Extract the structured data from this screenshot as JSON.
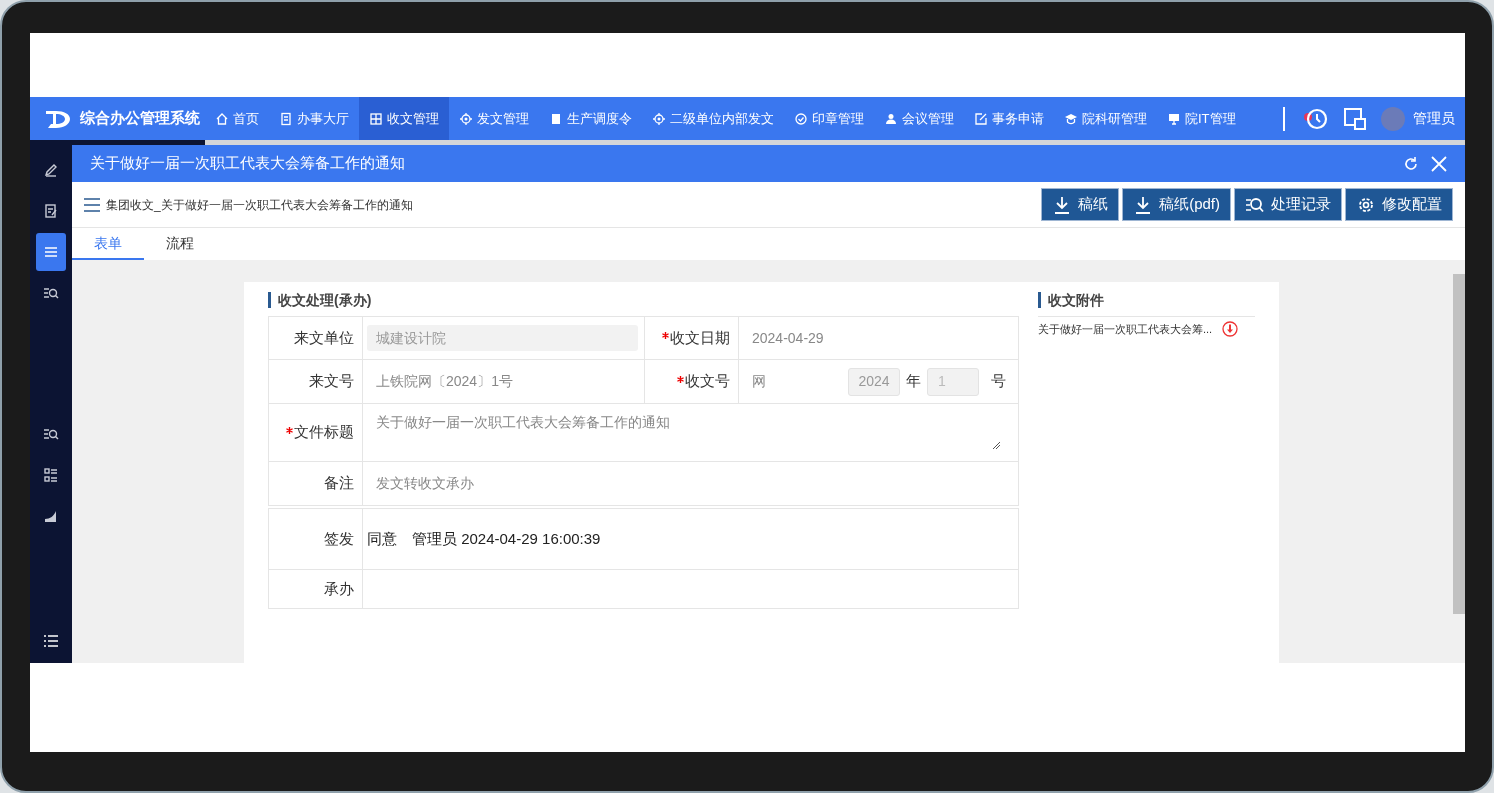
{
  "nav": {
    "logo_text": "综合办公管理系统",
    "items": [
      {
        "label": "首页",
        "kind": "home",
        "selected": false
      },
      {
        "label": "办事大厅",
        "kind": "doc",
        "selected": false
      },
      {
        "label": "收文管理",
        "kind": "grid",
        "selected": true
      },
      {
        "label": "发文管理",
        "kind": "gear",
        "selected": false
      },
      {
        "label": "生产调度令",
        "kind": "square",
        "selected": false
      },
      {
        "label": "二级单位内部发文",
        "kind": "gear",
        "selected": false
      },
      {
        "label": "印章管理",
        "kind": "check",
        "selected": false
      },
      {
        "label": "会议管理",
        "kind": "user",
        "selected": false
      },
      {
        "label": "事务申请",
        "kind": "edit",
        "selected": false
      },
      {
        "label": "院科研管理",
        "kind": "cap",
        "selected": false
      },
      {
        "label": "院IT管理",
        "kind": "monitor",
        "selected": false
      }
    ],
    "user": "管理员"
  },
  "sidebar": {
    "items": [
      {
        "kind": "pencil",
        "selected": false
      },
      {
        "kind": "note",
        "selected": false
      },
      {
        "kind": "menu",
        "selected": true
      },
      {
        "kind": "search-list",
        "selected": false
      }
    ],
    "lower_items": [
      {
        "kind": "search-list",
        "selected": false
      },
      {
        "kind": "grid-list",
        "selected": false
      },
      {
        "kind": "chart",
        "selected": false
      }
    ],
    "bottom": {
      "kind": "list",
      "selected": false
    }
  },
  "dialog": {
    "title": "关于做好一届一次职工代表大会筹备工作的通知",
    "breadcrumb": "集团收文_关于做好一届一次职工代表大会筹备工作的通知",
    "buttons": [
      {
        "label": "稿纸",
        "kind": "download"
      },
      {
        "label": "稿纸(pdf)",
        "kind": "download"
      },
      {
        "label": "处理记录",
        "kind": "search-list"
      },
      {
        "label": "修改配置",
        "kind": "gear"
      }
    ],
    "tabs": [
      {
        "label": "表单",
        "selected": true
      },
      {
        "label": "流程",
        "selected": false
      }
    ]
  },
  "form": {
    "title": "收文处理(承办)",
    "source_unit": {
      "label": "来文单位",
      "required": false,
      "value": "城建设计院"
    },
    "receive_date": {
      "label": "收文日期",
      "required": true,
      "value": "2024-04-29"
    },
    "source_number": {
      "label": "来文号",
      "required": false,
      "value": "上铁院网〔2024〕1号"
    },
    "receive_number": {
      "label": "收文号",
      "required": true,
      "prefix": "网",
      "year": "2024",
      "year_suffix": "年",
      "seq": "1",
      "seq_suffix": "号"
    },
    "doc_title": {
      "label": "文件标题",
      "required": true,
      "value": "关于做好一届一次职工代表大会筹备工作的通知"
    },
    "remark": {
      "label": "备注",
      "required": false,
      "value": "发文转收文承办"
    },
    "approvals": [
      {
        "label": "签发",
        "value": "同意　管理员 2024-04-29 16:00:39"
      },
      {
        "label": "承办"
      }
    ]
  },
  "attachments": {
    "title": "收文附件",
    "files": [
      {
        "name": "关于做好一届一次职工代表大会筹..."
      }
    ]
  }
}
